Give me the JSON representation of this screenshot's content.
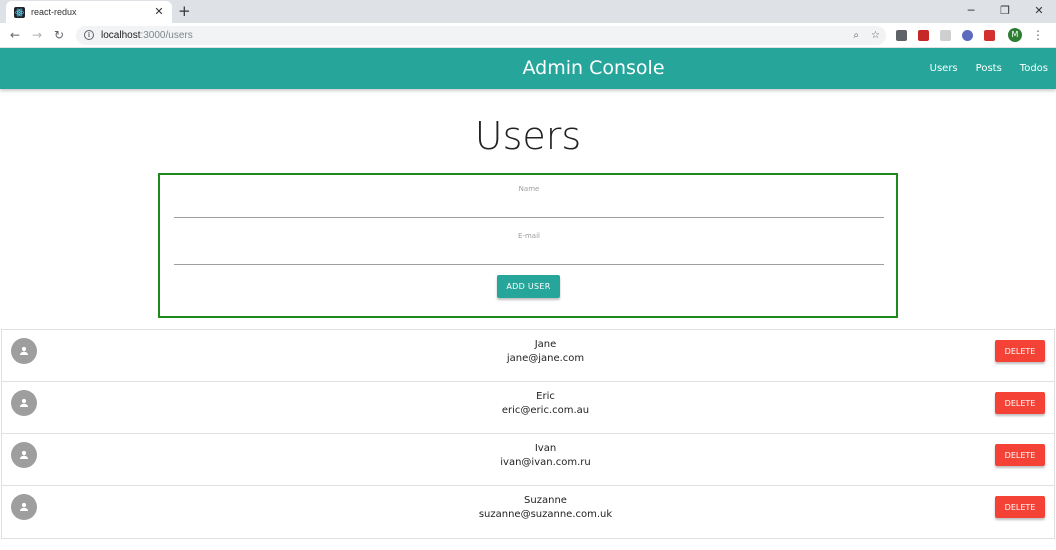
{
  "browser": {
    "tab_title": "react-redux",
    "tab_close": "✕",
    "new_tab": "+",
    "url_host": "localhost",
    "url_path": ":3000/users",
    "profile_initial": "M",
    "window_controls": [
      "─",
      "❐",
      "✕"
    ]
  },
  "header": {
    "brand": "Admin Console",
    "links": [
      "Users",
      "Posts",
      "Todos"
    ],
    "color": "#26a69a"
  },
  "page": {
    "title": "Users"
  },
  "form": {
    "name_label": "Name",
    "name_value": "",
    "email_label": "E-mail",
    "email_value": "",
    "add_button": "ADD USER",
    "border_color": "#1e8a1e"
  },
  "users": [
    {
      "name": "Jane",
      "email": "jane@jane.com",
      "delete_label": "DELETE"
    },
    {
      "name": "Eric",
      "email": "eric@eric.com.au",
      "delete_label": "DELETE"
    },
    {
      "name": "Ivan",
      "email": "ivan@ivan.com.ru",
      "delete_label": "DELETE"
    },
    {
      "name": "Suzanne",
      "email": "suzanne@suzanne.com.uk",
      "delete_label": "DELETE"
    }
  ],
  "colors": {
    "delete": "#f44336",
    "avatar": "#9e9e9e"
  },
  "icons": {
    "tab_favicon": "react-logo-icon",
    "back": "back-arrow-icon",
    "forward": "forward-arrow-icon",
    "reload": "reload-icon",
    "site_info": "info-icon",
    "zoom": "zoom-icon",
    "bookmark": "star-icon",
    "avatar": "account-circle-icon"
  }
}
